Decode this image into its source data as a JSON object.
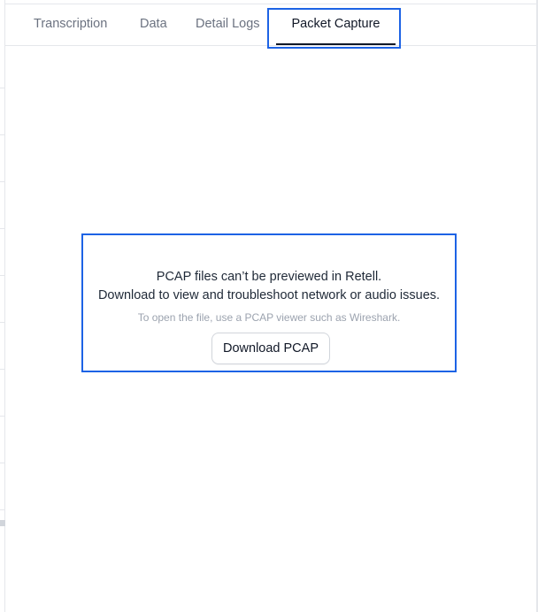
{
  "tabs": [
    {
      "label": "Transcription",
      "active": false
    },
    {
      "label": "Data",
      "active": false
    },
    {
      "label": "Detail Logs",
      "active": false
    },
    {
      "label": "Packet Capture",
      "active": true
    }
  ],
  "message": {
    "line1": "PCAP files can’t be previewed in Retell.",
    "line2": "Download to view and troubleshoot network or audio issues.",
    "hint": "To open the file, use a PCAP viewer such as Wireshark.",
    "button_label": "Download PCAP"
  },
  "colors": {
    "highlight": "#1d63e5",
    "text_primary": "#111827",
    "text_muted": "#6b7280",
    "text_hint": "#9ca3af",
    "border": "#e5e7eb"
  }
}
